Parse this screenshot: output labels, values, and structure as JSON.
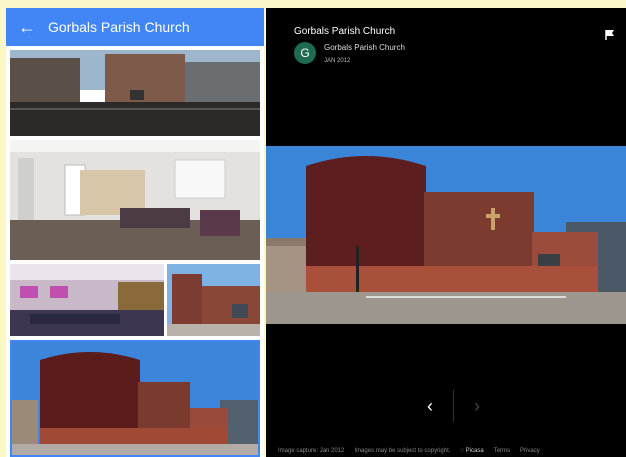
{
  "sidebar": {
    "title": "Gorbals Parish Church",
    "back_icon": "arrow-left-icon",
    "photos": [
      {
        "name": "street-view-photo"
      },
      {
        "name": "hall-interior-photo"
      },
      {
        "name": "auditorium-photo"
      },
      {
        "name": "building-corner-photo"
      },
      {
        "name": "church-exterior-photo",
        "selected": true
      }
    ]
  },
  "viewer": {
    "title": "Gorbals Parish Church",
    "avatar_letter": "G",
    "author": "Gorbals Parish Church",
    "date": "JAN 2012",
    "prev_symbol": "‹",
    "next_symbol": "›",
    "flag_icon": "flag-icon"
  },
  "footer": {
    "capture": "Image capture: Jan 2012",
    "copyright": "Images may be subject to copyright.",
    "brand": "Picasa",
    "terms": "Terms",
    "privacy": "Privacy"
  },
  "colors": {
    "header_blue": "#4285f4",
    "avatar_green": "#1e6b52",
    "background_yellow": "#fbf7c9"
  }
}
